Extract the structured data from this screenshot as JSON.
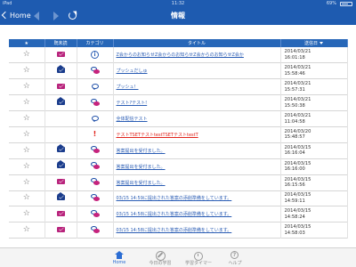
{
  "status_bar": {
    "carrier": "iPad",
    "time": "11:32",
    "battery": "69%"
  },
  "nav": {
    "back_label": "Home",
    "title": "情報"
  },
  "table": {
    "headers": {
      "star": "★",
      "unread": "既未読",
      "category": "カテゴリ",
      "title": "タイトル",
      "date": "送信日"
    },
    "rows": [
      {
        "mail": "unread",
        "category": "info",
        "title": "Z会からのお知らせZ会からのお知らせZ会からのお知らせZ会か",
        "date": "2014/03/21",
        "time": "16:01:18",
        "title_style": "link"
      },
      {
        "mail": "read",
        "category": "chat-pink",
        "title": "プッシュだしゅ",
        "date": "2014/03/21",
        "time": "15:58:46",
        "title_style": "link"
      },
      {
        "mail": "unread",
        "category": "chat-blue",
        "title": "プッシュ！",
        "date": "2014/03/21",
        "time": "15:57:31",
        "title_style": "link"
      },
      {
        "mail": "read",
        "category": "chat-pink",
        "title": "テスト?テスト!",
        "date": "2014/03/21",
        "time": "15:50:38",
        "title_style": "link"
      },
      {
        "mail": "none",
        "category": "chat-blue",
        "title": "全体配信テスト",
        "date": "2014/03/21",
        "time": "11:04:58",
        "title_style": "link"
      },
      {
        "mail": "none",
        "category": "alert",
        "title": "テストTSETテストtestTSETテストtestT",
        "date": "2014/03/20",
        "time": "15:48:57",
        "title_style": "alert"
      },
      {
        "mail": "read",
        "category": "chat-pink",
        "title": "答案提出を受付ました。",
        "date": "2014/03/15",
        "time": "16:16:04",
        "title_style": "link"
      },
      {
        "mail": "read",
        "category": "chat-pink",
        "title": "答案提出を受付ました。",
        "date": "2014/03/15",
        "time": "16:16:00",
        "title_style": "link"
      },
      {
        "mail": "unread",
        "category": "chat-pink",
        "title": "答案提出を受付ました。",
        "date": "2014/03/15",
        "time": "16:15:56",
        "title_style": "link"
      },
      {
        "mail": "read",
        "category": "chat-pink",
        "title": "03/15 14:59に提出された答案の添削準備をしています。",
        "date": "2014/03/15",
        "time": "14:59:11",
        "title_style": "link"
      },
      {
        "mail": "unread",
        "category": "chat-pink",
        "title": "03/15 14:58に提出された答案の添削準備をしています。",
        "date": "2014/03/15",
        "time": "14:58:24",
        "title_style": "link"
      },
      {
        "mail": "unread",
        "category": "chat-pink",
        "title": "03/15 14:58に提出された答案の添削準備をしています。",
        "date": "2014/03/15",
        "time": "14:58:03",
        "title_style": "link"
      }
    ]
  },
  "tabs": [
    {
      "id": "home",
      "label": "Home",
      "icon": "home-icon",
      "active": true
    },
    {
      "id": "study",
      "label": "今日の学習",
      "icon": "pencil-icon",
      "active": false
    },
    {
      "id": "timer",
      "label": "学習タイマー",
      "icon": "timer-icon",
      "active": false
    },
    {
      "id": "help",
      "label": "ヘルプ",
      "icon": "help-icon",
      "active": false
    }
  ],
  "colors": {
    "nav_blue": "#1e5bb0",
    "header_blue": "#2767b8",
    "link": "#2b5db4",
    "alert": "#e0231b",
    "unread_mail": "#b8237c",
    "read_mail": "#1a3c8c",
    "active_tab": "#2b6dd3"
  }
}
